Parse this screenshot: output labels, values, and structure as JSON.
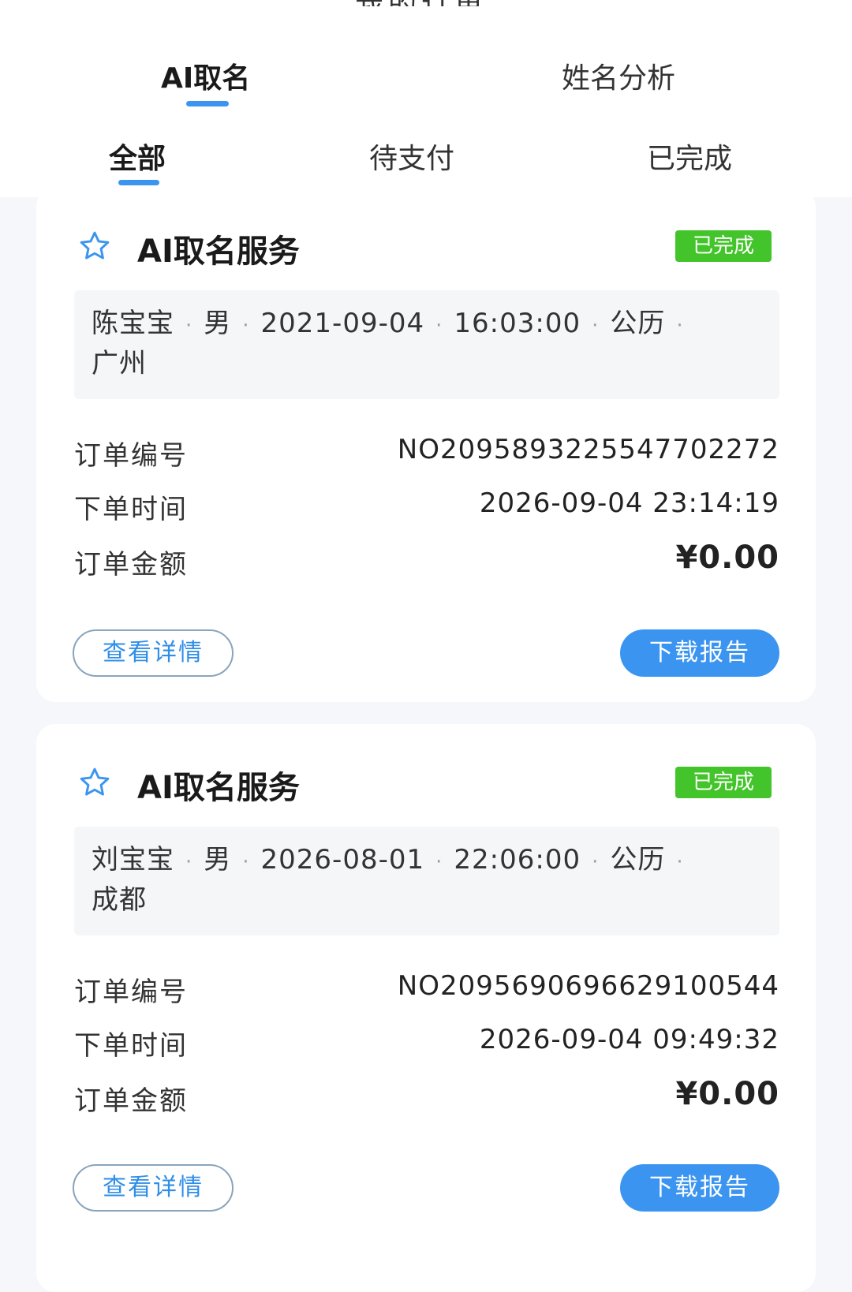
{
  "header": {
    "title_fragment": "我的订单",
    "main_tabs": [
      {
        "label": "AI取名",
        "active": true
      },
      {
        "label": "姓名分析",
        "active": false
      }
    ],
    "sub_tabs": [
      {
        "label": "全部",
        "active": true
      },
      {
        "label": "待支付",
        "active": false
      },
      {
        "label": "已完成",
        "active": false
      }
    ]
  },
  "colors": {
    "accent": "#3b95f0",
    "badge_green": "#43c42a"
  },
  "orders": [
    {
      "service_title": "AI取名服务",
      "status": "已完成",
      "name": "陈宝宝",
      "gender": "男",
      "birth_date": "2021-09-04",
      "birth_time": "16:03:00",
      "calendar": "公历",
      "city": "广州",
      "labels": {
        "order_no": "订单编号",
        "order_time": "下单时间",
        "amount": "订单金额"
      },
      "order_no": "NO2095893225547702272",
      "order_time": "2026-09-04 23:14:19",
      "amount": "¥0.00",
      "buttons": {
        "details": "查看详情",
        "download": "下载报告"
      }
    },
    {
      "service_title": "AI取名服务",
      "status": "已完成",
      "name": "刘宝宝",
      "gender": "男",
      "birth_date": "2026-08-01",
      "birth_time": "22:06:00",
      "calendar": "公历",
      "city": "成都",
      "labels": {
        "order_no": "订单编号",
        "order_time": "下单时间",
        "amount": "订单金额"
      },
      "order_no": "NO2095690696629100544",
      "order_time": "2026-09-04 09:49:32",
      "amount": "¥0.00",
      "buttons": {
        "details": "查看详情",
        "download": "下载报告"
      }
    }
  ]
}
